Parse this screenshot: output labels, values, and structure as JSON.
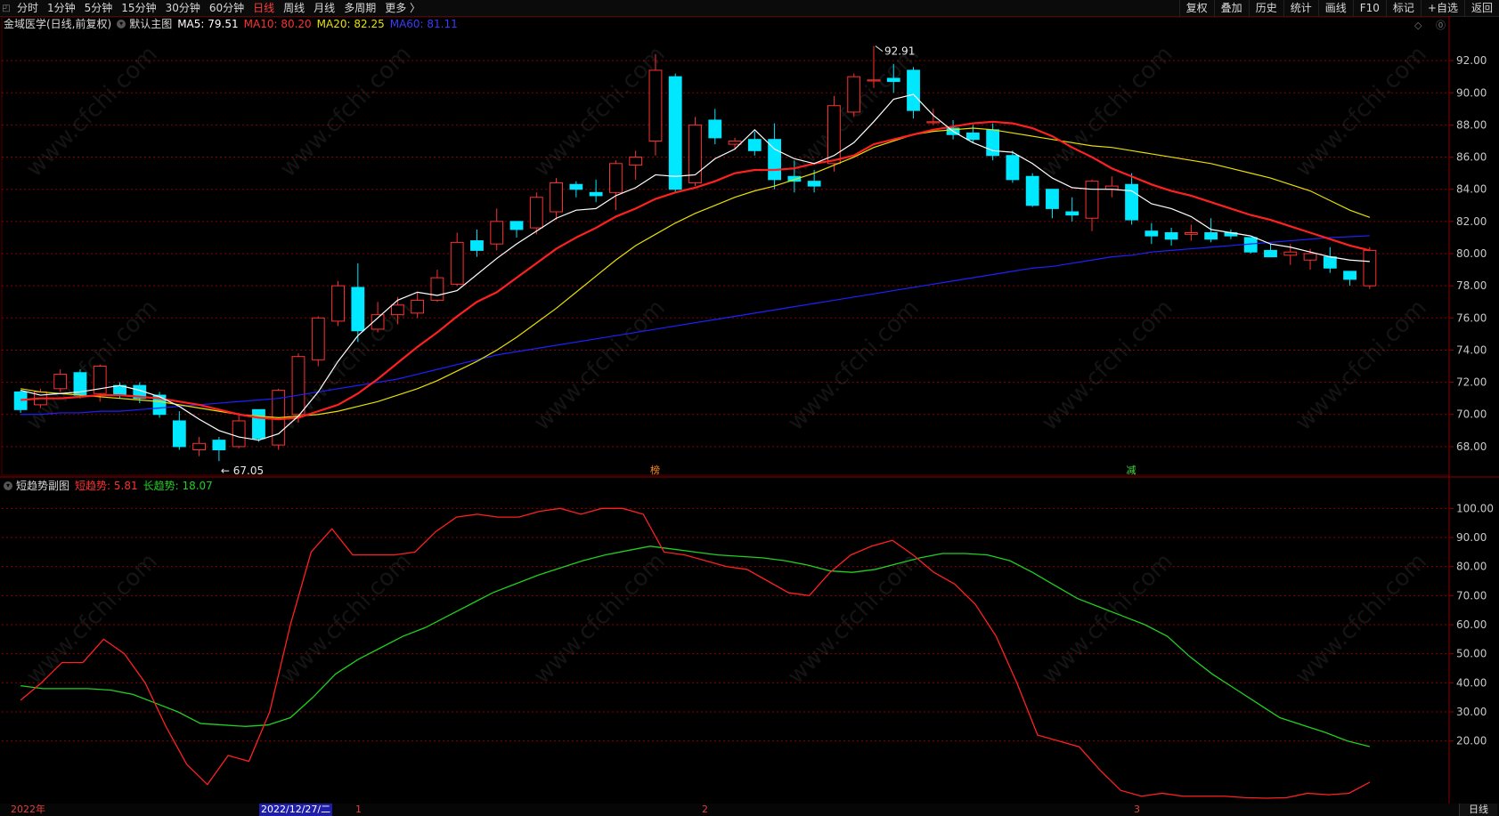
{
  "toolbar": {
    "dock_icon": "dock-icon",
    "left_items": [
      "分时",
      "1分钟",
      "5分钟",
      "15分钟",
      "30分钟",
      "60分钟",
      "日线",
      "周线",
      "月线",
      "多周期",
      "更多 〉"
    ],
    "active_item": "日线",
    "right_items": [
      "复权",
      "叠加",
      "历史",
      "统计",
      "画线",
      "F10",
      "标记",
      "+自选",
      "返回"
    ]
  },
  "main_legend": {
    "stock": "金域医学(日线,前复权)",
    "chart_name": "默认主图",
    "ma5": "MA5: 79.51",
    "ma10": "MA10: 80.20",
    "ma20": "MA20: 82.25",
    "ma60": "MA60: 81.11"
  },
  "sub_legend": {
    "name": "短趋势副图",
    "short": "短趋势: 5.81",
    "long": "长趋势: 18.07"
  },
  "right_icons": "◇ ⓪",
  "annotations": {
    "high": "92.91",
    "low": "67.05",
    "mark1": "榜",
    "mark2": "减"
  },
  "main_axis_labels": [
    "92.00",
    "90.00",
    "88.00",
    "86.00",
    "84.00",
    "82.00",
    "80.00",
    "78.00",
    "76.00",
    "74.00",
    "72.00",
    "70.00",
    "68.00"
  ],
  "sub_axis_labels": [
    "100.00",
    "90.00",
    "80.00",
    "70.00",
    "60.00",
    "50.00",
    "40.00",
    "30.00",
    "20.00"
  ],
  "date_axis": {
    "year_label": "2022年",
    "cursor_date": "2022/12/27/二",
    "months": [
      "1",
      "2",
      "3"
    ],
    "period_button": "日线"
  },
  "watermark": "www.cfchi.com",
  "colors": {
    "up": "#ff3030",
    "down": "#00e8ff",
    "ma5": "#ffffff",
    "ma10": "#ff2020",
    "ma20": "#e8e000",
    "ma60": "#2020ff",
    "short_trend": "#ff2020",
    "long_trend": "#20d020",
    "grid": "#8b0000"
  },
  "chart_data": {
    "type": "candlestick",
    "y_range_main": [
      66.5,
      93.5
    ],
    "y_range_sub": [
      0,
      105
    ],
    "candles": [
      [
        71.4,
        70.3,
        70.1,
        71.5
      ],
      [
        70.6,
        71.4,
        70.4,
        71.6
      ],
      [
        71.6,
        72.5,
        71.4,
        72.8
      ],
      [
        72.6,
        71.2,
        71.0,
        72.8
      ],
      [
        71.3,
        73.0,
        70.8,
        73.1
      ],
      [
        71.8,
        71.2,
        71.0,
        72.0
      ],
      [
        71.8,
        71.0,
        70.7,
        72.0
      ],
      [
        71.2,
        70.0,
        69.8,
        71.4
      ],
      [
        69.6,
        68.0,
        67.8,
        70.2
      ],
      [
        67.8,
        68.2,
        67.4,
        68.6
      ],
      [
        68.4,
        67.8,
        67.1,
        68.6
      ],
      [
        68.0,
        69.6,
        67.9,
        70.1
      ],
      [
        70.3,
        68.5,
        68.3,
        70.3
      ],
      [
        68.1,
        71.5,
        67.8,
        71.6
      ],
      [
        70.0,
        73.6,
        69.5,
        73.8
      ],
      [
        73.4,
        76.0,
        73.0,
        76.1
      ],
      [
        75.8,
        78.0,
        75.5,
        78.3
      ],
      [
        77.9,
        75.2,
        74.5,
        79.4
      ],
      [
        75.3,
        76.2,
        75.1,
        77.0
      ],
      [
        76.2,
        76.8,
        75.6,
        77.3
      ],
      [
        76.3,
        77.1,
        76.0,
        77.6
      ],
      [
        77.1,
        78.5,
        77.0,
        79.0
      ],
      [
        78.1,
        80.7,
        78.0,
        81.3
      ],
      [
        80.8,
        80.2,
        79.8,
        81.5
      ],
      [
        80.6,
        82.0,
        80.2,
        82.8
      ],
      [
        82.0,
        81.5,
        81.0,
        81.8
      ],
      [
        81.6,
        83.5,
        81.2,
        83.8
      ],
      [
        82.6,
        84.4,
        82.1,
        84.7
      ],
      [
        84.3,
        84.0,
        83.5,
        84.5
      ],
      [
        83.8,
        83.6,
        83.2,
        84.6
      ],
      [
        83.8,
        85.6,
        82.7,
        85.8
      ],
      [
        85.5,
        86.0,
        84.6,
        86.4
      ],
      [
        87.0,
        91.4,
        86.1,
        92.4
      ],
      [
        91.0,
        84.0,
        83.8,
        91.2
      ],
      [
        84.4,
        88.0,
        84.2,
        88.5
      ],
      [
        88.3,
        87.2,
        86.8,
        89.0
      ],
      [
        86.8,
        87.0,
        86.5,
        87.2
      ],
      [
        87.1,
        86.4,
        86.1,
        87.6
      ],
      [
        87.1,
        84.6,
        84.0,
        88.1
      ],
      [
        84.8,
        84.5,
        83.8,
        85.8
      ],
      [
        84.5,
        84.2,
        83.8,
        85.2
      ],
      [
        85.6,
        89.2,
        85.1,
        89.8
      ],
      [
        88.8,
        91.0,
        88.5,
        91.2
      ],
      [
        90.8,
        90.8,
        90.3,
        92.91
      ],
      [
        90.9,
        90.7,
        90.0,
        91.8
      ],
      [
        91.4,
        88.9,
        88.4,
        91.6
      ],
      [
        88.2,
        88.2,
        88.0,
        89.0
      ],
      [
        87.8,
        87.4,
        87.1,
        88.3
      ],
      [
        87.5,
        87.1,
        86.9,
        88.0
      ],
      [
        87.7,
        86.1,
        85.8,
        88.1
      ],
      [
        86.1,
        84.6,
        84.4,
        86.4
      ],
      [
        84.8,
        83.0,
        82.9,
        85.0
      ],
      [
        84.0,
        82.8,
        82.2,
        84.0
      ],
      [
        82.6,
        82.4,
        82.0,
        83.5
      ],
      [
        82.2,
        84.5,
        81.4,
        84.6
      ],
      [
        84.0,
        84.2,
        83.5,
        84.8
      ],
      [
        84.3,
        82.1,
        81.8,
        85.0
      ],
      [
        81.4,
        81.1,
        80.6,
        81.9
      ],
      [
        81.3,
        80.9,
        80.5,
        81.6
      ],
      [
        81.2,
        81.3,
        80.8,
        81.8
      ],
      [
        81.3,
        80.9,
        80.7,
        82.2
      ],
      [
        81.3,
        81.1,
        80.9,
        81.5
      ],
      [
        81.0,
        80.1,
        80.0,
        81.0
      ],
      [
        80.2,
        79.8,
        79.8,
        80.6
      ],
      [
        79.9,
        80.1,
        79.3,
        80.6
      ],
      [
        79.6,
        80.0,
        79.0,
        80.3
      ],
      [
        79.8,
        79.1,
        78.8,
        80.4
      ],
      [
        78.9,
        78.4,
        78.0,
        78.9
      ],
      [
        78.0,
        80.2,
        77.8,
        80.4
      ]
    ],
    "ma5": [
      71.5,
      71.2,
      71.3,
      71.4,
      71.6,
      71.8,
      71.5,
      71.1,
      70.5,
      69.7,
      69.0,
      68.6,
      68.4,
      68.8,
      69.9,
      71.4,
      73.3,
      74.9,
      76.0,
      77.1,
      77.6,
      77.4,
      77.7,
      78.7,
      79.7,
      80.6,
      81.4,
      82.2,
      82.7,
      82.8,
      83.6,
      84.1,
      84.9,
      84.8,
      84.9,
      85.9,
      86.5,
      87.7,
      86.5,
      85.9,
      85.6,
      86.1,
      86.9,
      88.2,
      89.6,
      89.9,
      88.6,
      87.6,
      86.9,
      86.4,
      86.3,
      85.6,
      84.7,
      84.1,
      84.0,
      84.0,
      83.9,
      83.1,
      82.8,
      82.3,
      81.5,
      81.3,
      81.1,
      80.6,
      80.4,
      80.1,
      79.8,
      79.6,
      79.51
    ],
    "ma10": [
      70.9,
      71.0,
      71.0,
      71.1,
      71.2,
      71.2,
      71.1,
      71.0,
      70.8,
      70.6,
      70.3,
      70.0,
      69.8,
      69.7,
      69.8,
      70.2,
      70.6,
      71.3,
      72.2,
      73.2,
      74.2,
      75.1,
      76.1,
      77.0,
      77.6,
      78.5,
      79.4,
      80.3,
      81.0,
      81.6,
      82.3,
      82.8,
      83.4,
      83.8,
      84.1,
      84.5,
      85.0,
      85.2,
      85.2,
      85.3,
      85.6,
      85.8,
      86.1,
      86.8,
      87.1,
      87.4,
      87.7,
      87.9,
      88.1,
      88.2,
      88.1,
      87.8,
      87.3,
      86.6,
      86.0,
      85.3,
      84.8,
      84.3,
      83.9,
      83.6,
      83.2,
      82.8,
      82.4,
      82.1,
      81.7,
      81.3,
      80.9,
      80.5,
      80.2
    ],
    "ma20": [
      71.6,
      71.4,
      71.3,
      71.2,
      71.1,
      71.0,
      70.9,
      70.8,
      70.6,
      70.4,
      70.2,
      70.0,
      69.9,
      69.8,
      69.9,
      70.0,
      70.2,
      70.5,
      70.8,
      71.2,
      71.6,
      72.1,
      72.7,
      73.3,
      74.0,
      74.8,
      75.7,
      76.6,
      77.6,
      78.6,
      79.6,
      80.5,
      81.2,
      81.9,
      82.5,
      83.0,
      83.5,
      83.9,
      84.2,
      84.6,
      85.0,
      85.5,
      86.0,
      86.6,
      87.0,
      87.4,
      87.6,
      87.7,
      87.8,
      87.7,
      87.5,
      87.3,
      87.1,
      86.9,
      86.7,
      86.6,
      86.4,
      86.2,
      86.0,
      85.8,
      85.6,
      85.3,
      85.0,
      84.7,
      84.3,
      83.9,
      83.3,
      82.7,
      82.25
    ],
    "ma60": [
      70.0,
      70.0,
      70.1,
      70.1,
      70.2,
      70.2,
      70.3,
      70.4,
      70.5,
      70.6,
      70.7,
      70.8,
      70.9,
      71.0,
      71.2,
      71.4,
      71.6,
      71.8,
      72.0,
      72.2,
      72.5,
      72.8,
      73.1,
      73.4,
      73.7,
      73.9,
      74.1,
      74.3,
      74.5,
      74.7,
      74.9,
      75.1,
      75.3,
      75.5,
      75.7,
      75.9,
      76.1,
      76.3,
      76.5,
      76.7,
      76.9,
      77.1,
      77.3,
      77.5,
      77.7,
      77.9,
      78.1,
      78.3,
      78.5,
      78.7,
      78.9,
      79.1,
      79.2,
      79.4,
      79.6,
      79.8,
      79.9,
      80.1,
      80.2,
      80.3,
      80.4,
      80.5,
      80.6,
      80.7,
      80.8,
      80.9,
      81.0,
      81.05,
      81.11
    ],
    "short_trend": [
      34,
      40,
      47,
      47,
      55,
      50,
      40,
      25,
      12,
      5,
      15,
      13,
      30,
      60,
      85,
      93,
      84,
      84,
      84,
      85,
      92,
      97,
      98,
      97,
      97,
      99,
      100,
      98,
      100,
      100,
      98,
      85,
      84,
      82,
      80,
      79,
      75,
      71,
      70,
      78,
      84,
      87,
      89,
      84,
      78,
      74,
      67,
      56,
      40,
      22,
      20,
      18,
      10,
      3,
      1,
      2,
      1,
      1,
      1,
      0.5,
      0.3,
      0.5,
      2,
      1.5,
      2,
      5.81
    ],
    "long_trend": [
      39,
      38,
      38,
      38,
      37.5,
      36,
      33,
      30,
      26,
      25.5,
      25,
      25.5,
      28,
      35,
      43,
      48,
      52,
      56,
      59,
      63,
      67,
      71,
      74,
      77,
      79.5,
      82,
      84,
      85.5,
      87,
      86,
      85,
      84,
      83.5,
      83,
      82,
      80.5,
      78.5,
      78,
      79,
      81,
      83,
      84.5,
      84.5,
      84,
      82,
      78,
      73.5,
      69,
      66,
      63,
      60,
      56,
      49,
      43,
      38,
      33,
      28,
      25.5,
      23,
      20,
      18.07
    ]
  }
}
